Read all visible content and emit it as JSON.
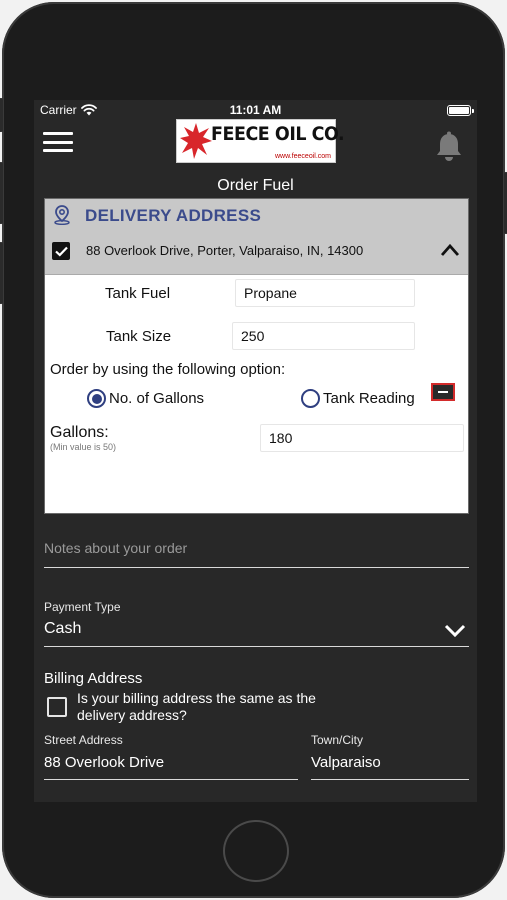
{
  "status": {
    "carrier": "Carrier",
    "time": "11:01 AM"
  },
  "nav": {
    "logo_text": "FEECE OIL CO.",
    "logo_url": "www.feeceoil.com",
    "title": "Order Fuel"
  },
  "delivery": {
    "heading": "DELIVERY ADDRESS",
    "address": "88 Overlook Drive, Porter, Valparaiso, IN, 14300",
    "address_checked": true,
    "tank_fuel_label": "Tank Fuel",
    "tank_fuel_value": "Propane",
    "tank_size_label": "Tank Size",
    "tank_size_value": "250",
    "order_option_prompt": "Order by using the following option:",
    "options": [
      {
        "label": "No. of Gallons",
        "selected": true
      },
      {
        "label": "Tank Reading",
        "selected": false
      }
    ],
    "gallons_label": "Gallons:",
    "gallons_hint": "(Min value is 50)",
    "gallons_value": "180"
  },
  "notes": {
    "placeholder": "Notes about your order"
  },
  "payment": {
    "label": "Payment Type",
    "value": "Cash"
  },
  "billing": {
    "heading": "Billing Address",
    "same_question_line1": "Is your billing address the same as the",
    "same_question_line2": "delivery address?",
    "same_checked": false,
    "street_label": "Street Address",
    "street_value": "88 Overlook Drive",
    "town_label": "Town/City",
    "town_value": "Valparaiso"
  },
  "colors": {
    "accent": "#2f3f80",
    "heading": "#3b4b8c",
    "screen_bg": "#282828",
    "card_header": "#c8c8c8",
    "alert": "#d32b2b"
  }
}
